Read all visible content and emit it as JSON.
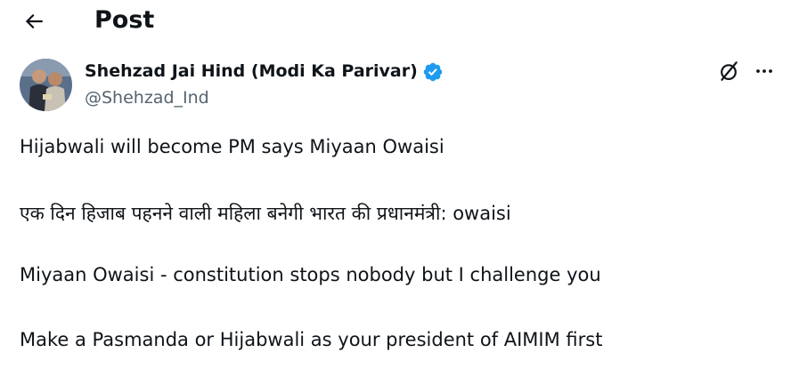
{
  "header": {
    "title": "Post",
    "back_icon": "arrow-left-icon"
  },
  "author": {
    "name": "Shehzad Jai Hind (Modi Ka Parivar)",
    "handle": "@Shehzad_Ind",
    "verified": true,
    "verified_color": "#1d9bf0"
  },
  "actions": {
    "grok_icon": "grok-icon",
    "more_icon": "more-horizontal-icon"
  },
  "tweet": {
    "lines": [
      "Hijabwali will become PM says Miyaan  Owaisi",
      "एक दिन हिजाब पहनने वाली महिला बनेगी भारत की प्रधानमंत्री: owaisi",
      "Miyaan Owaisi - constitution stops nobody but I challenge you",
      "Make a Pasmanda or Hijabwali as your president of AIMIM first"
    ]
  },
  "colors": {
    "text_primary": "#0f1419",
    "text_secondary": "#536471",
    "accent": "#1d9bf0"
  }
}
